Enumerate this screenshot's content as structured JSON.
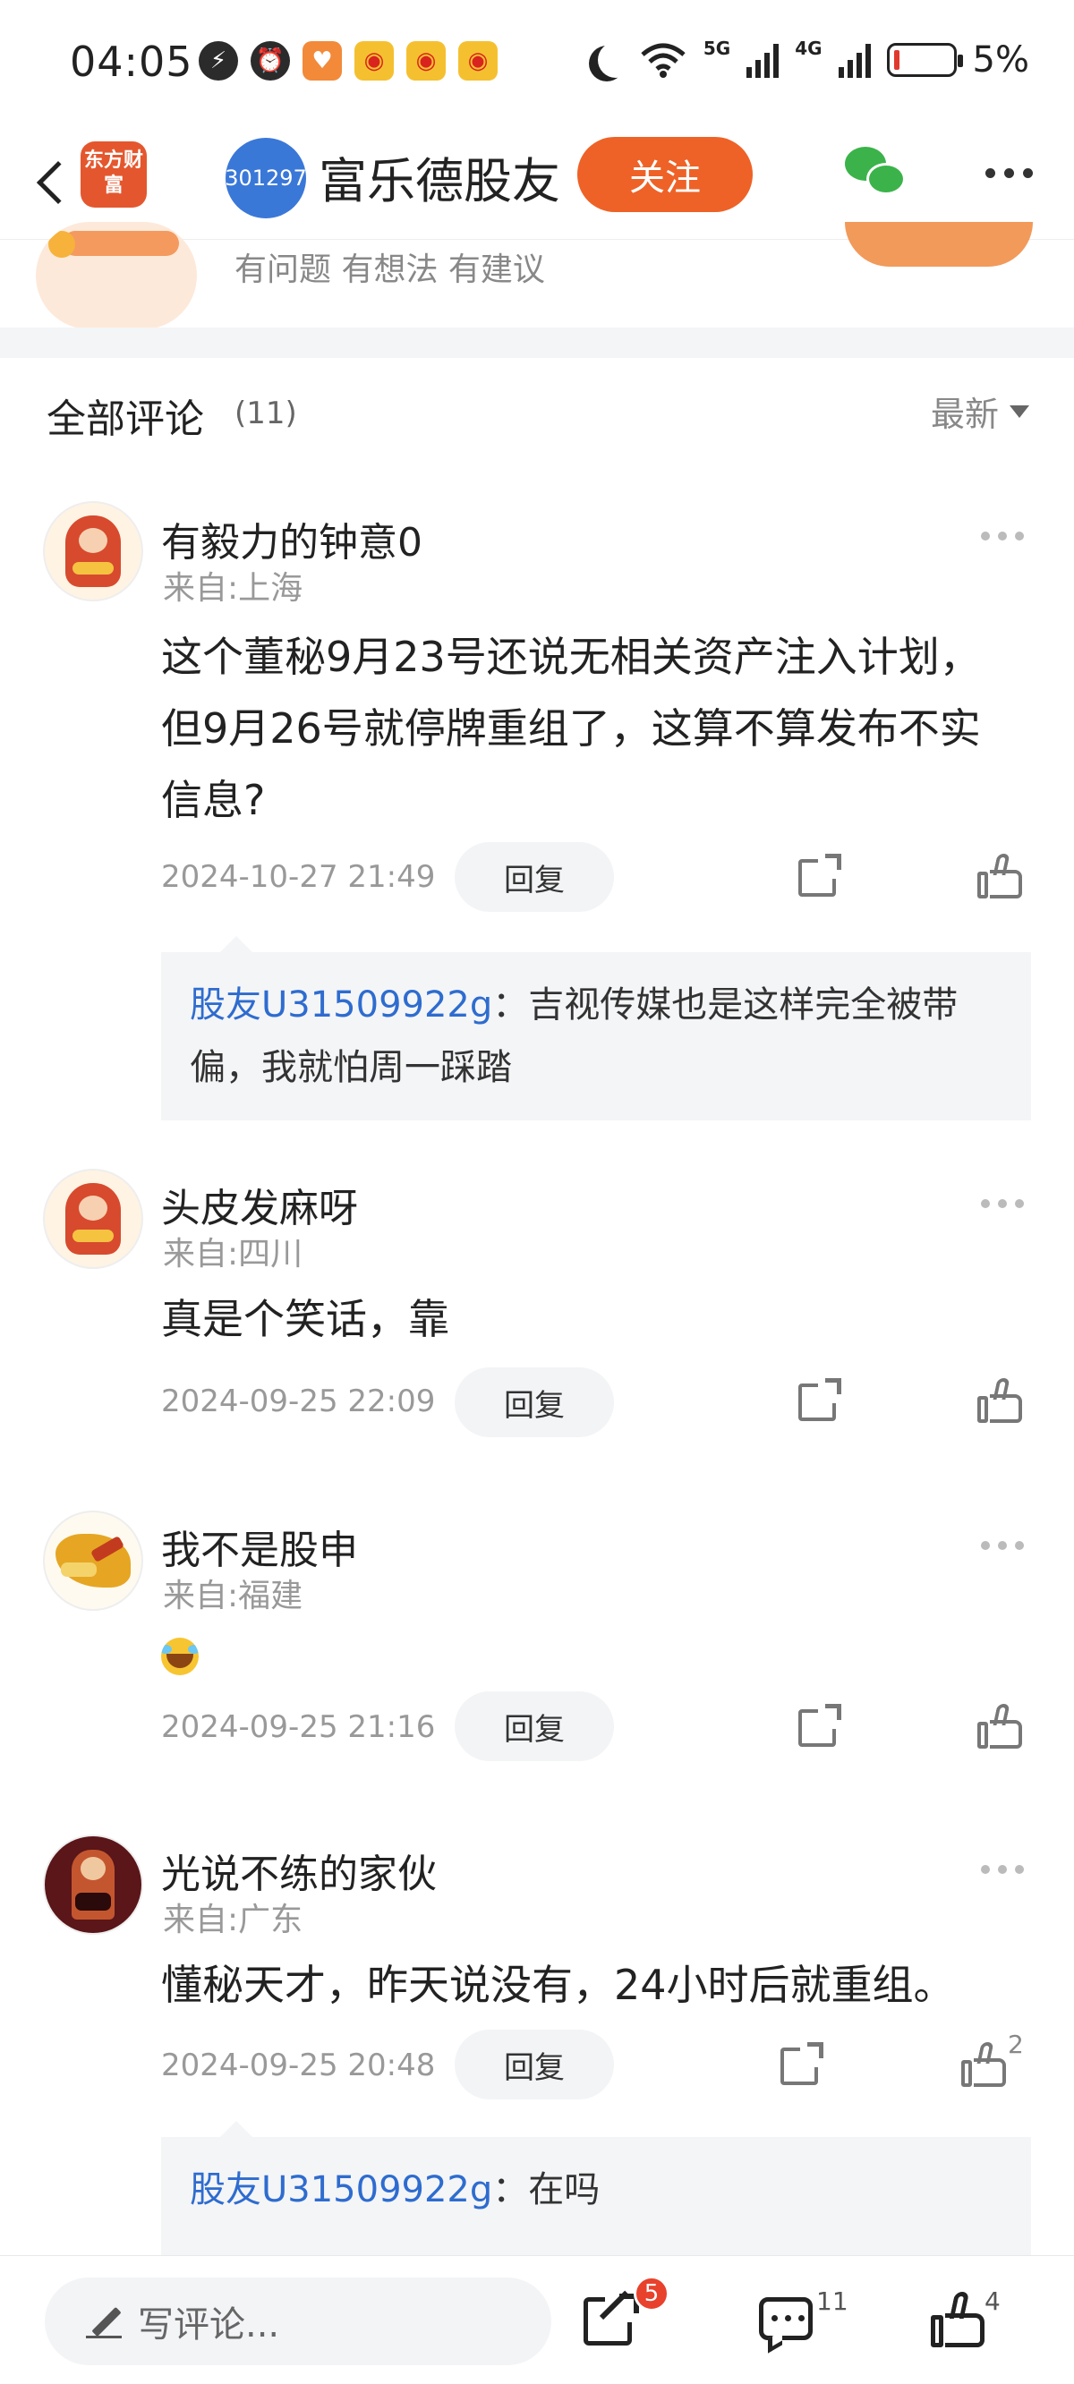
{
  "status_bar": {
    "time": "04:05",
    "network_5g": "5G",
    "network_4g": "4G",
    "battery": "5%",
    "icons": [
      "charging-icon",
      "alarm-icon",
      "heart-app-icon",
      "weibo-icon",
      "weibo-icon",
      "weibo-icon"
    ]
  },
  "nav": {
    "logo_text": "东方财富",
    "stock_code": "301297",
    "title": "富乐德股友",
    "follow_label": "关注"
  },
  "banner": {
    "text": "有问题 有想法 有建议"
  },
  "comments_section": {
    "title": "全部评论",
    "count": "(11)",
    "sort_label": "最新"
  },
  "comments": [
    {
      "name": "有毅力的钟意0",
      "from": "来自:上海",
      "body": "这个董秘9月23号还说无相关资产注入计划，但9月26号就停牌重组了，这算不算发布不实信息?",
      "time": "2024-10-27 21:49",
      "reply_label": "回复",
      "likes": "",
      "quote": {
        "who": "股友U31509922g",
        "text": "：吉视传媒也是这样完全被带偏，我就怕周一踩踏"
      }
    },
    {
      "name": "头皮发麻呀",
      "from": "来自:四川",
      "body": "真是个笑话，靠",
      "time": "2024-09-25 22:09",
      "reply_label": "回复",
      "likes": ""
    },
    {
      "name": "我不是股申",
      "from": "来自:福建",
      "body": "",
      "emoji": "laughing-crying-emoji",
      "time": "2024-09-25 21:16",
      "reply_label": "回复",
      "likes": ""
    },
    {
      "name": "光说不练的家伙",
      "from": "来自:广东",
      "body": "懂秘天才，昨天说没有，24小时后就重组。",
      "time": "2024-09-25 20:48",
      "reply_label": "回复",
      "likes": "2",
      "quote": {
        "who": "股友U31509922g",
        "text": "：在吗"
      }
    }
  ],
  "bottom_bar": {
    "write_placeholder": "写评论...",
    "share_badge": "5",
    "comment_count": "11",
    "like_count": "4"
  },
  "colors": {
    "accent": "#ee6227",
    "link_blue": "#2e6ccf",
    "badge_red": "#e8412c"
  }
}
